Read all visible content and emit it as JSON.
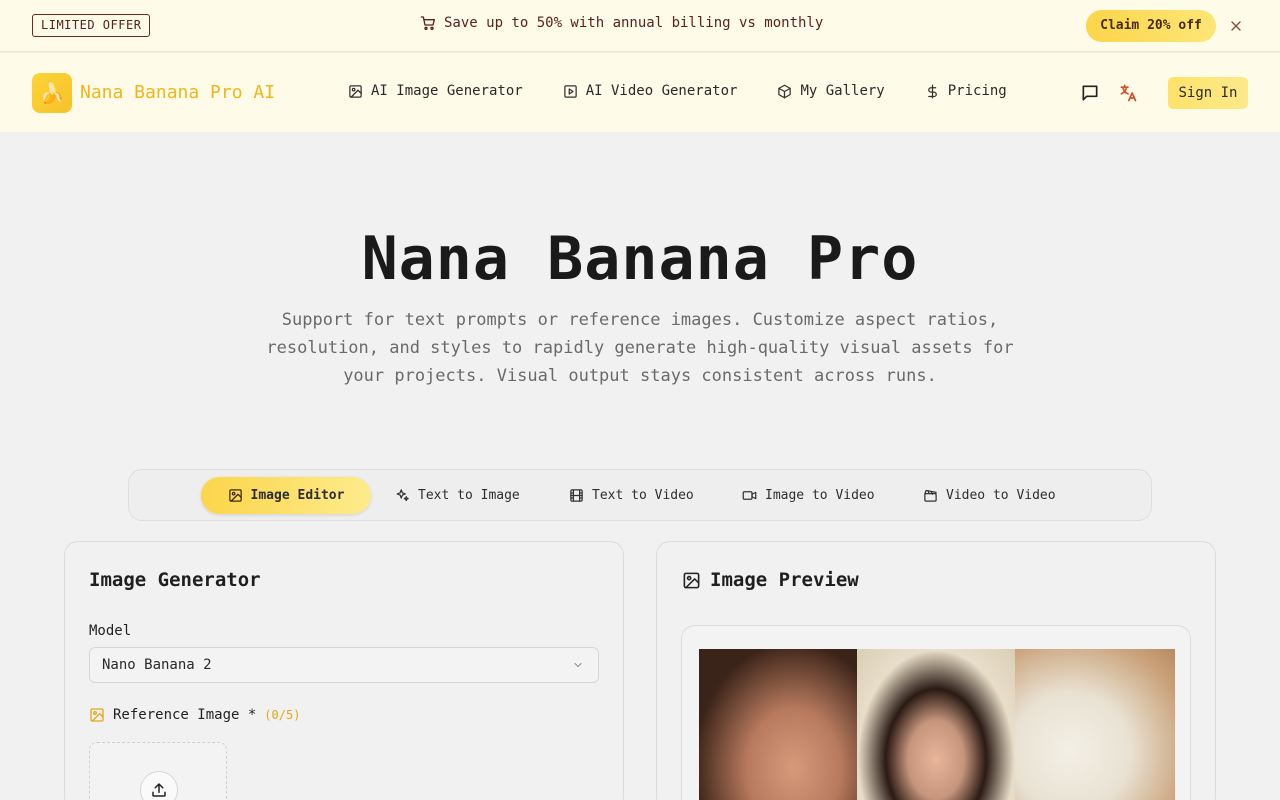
{
  "promo": {
    "badge": "LIMITED OFFER",
    "message": "Save up to 50% with annual billing vs monthly",
    "claim_label": "Claim 20% off"
  },
  "header": {
    "brand": "Nana Banana Pro AI",
    "nav": [
      {
        "label": "AI Image Generator",
        "icon": "image-icon"
      },
      {
        "label": "AI Video Generator",
        "icon": "play-icon"
      },
      {
        "label": "My Gallery",
        "icon": "cube-icon"
      },
      {
        "label": "Pricing",
        "icon": "dollar-icon"
      }
    ],
    "sign_in": "Sign In"
  },
  "hero": {
    "title": "Nana Banana Pro",
    "subtitle": "Support for text prompts or reference images. Customize aspect ratios, resolution, and styles to rapidly generate high-quality visual assets for your projects. Visual output stays consistent across runs."
  },
  "tabs": [
    {
      "label": "Image Editor",
      "active": true
    },
    {
      "label": "Text to Image",
      "active": false
    },
    {
      "label": "Text to Video",
      "active": false
    },
    {
      "label": "Image to Video",
      "active": false
    },
    {
      "label": "Video to Video",
      "active": false
    }
  ],
  "generator": {
    "title": "Image Generator",
    "model_label": "Model",
    "model_value": "Nano Banana 2",
    "reference_label": "Reference Image *",
    "reference_count": "(0/5)"
  },
  "preview": {
    "title": "Image Preview"
  },
  "colors": {
    "accent": "#fcd54a",
    "brand_text": "#f0b51c",
    "promo_bg": "#fefbe8"
  }
}
